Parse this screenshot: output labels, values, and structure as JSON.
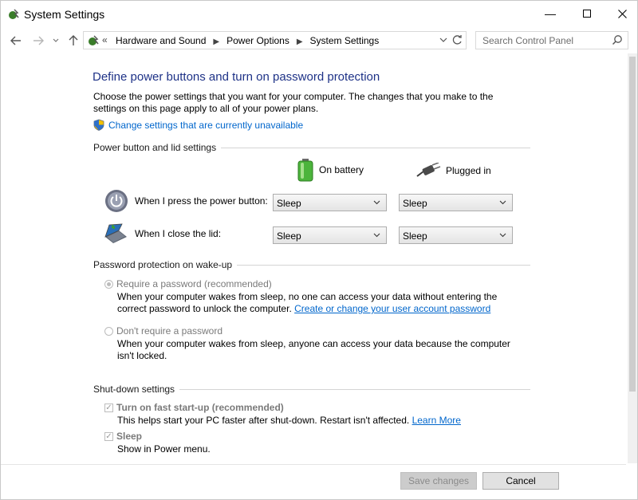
{
  "window": {
    "title": "System Settings",
    "minimize_icon": "minimize-icon",
    "maximize_icon": "maximize-icon",
    "close_icon": "close-icon"
  },
  "nav": {
    "overflow_chevron": "«",
    "breadcrumbs": [
      "Hardware and Sound",
      "Power Options",
      "System Settings"
    ],
    "search_placeholder": "Search Control Panel"
  },
  "page": {
    "heading": "Define power buttons and turn on password protection",
    "intro": "Choose the power settings that you want for your computer. The changes that you make to the settings on this page apply to all of your power plans.",
    "change_link": "Change settings that are currently unavailable"
  },
  "power_section": {
    "title": "Power button and lid settings",
    "col_battery": "On battery",
    "col_plugged": "Plugged in",
    "rows": [
      {
        "label": "When I press the power button:",
        "battery": "Sleep",
        "plugged": "Sleep"
      },
      {
        "label": "When I close the lid:",
        "battery": "Sleep",
        "plugged": "Sleep"
      }
    ]
  },
  "password_section": {
    "title": "Password protection on wake-up",
    "require_label": "Require a password (recommended)",
    "require_desc": "When your computer wakes from sleep, no one can access your data without entering the correct password to unlock the computer.",
    "require_link": "Create or change your user account password",
    "dont_label": "Don't require a password",
    "dont_desc": "When your computer wakes from sleep, anyone can access your data because the computer isn't locked.",
    "selected": "require"
  },
  "shutdown_section": {
    "title": "Shut-down settings",
    "fast_label": "Turn on fast start-up (recommended)",
    "fast_desc": "This helps start your PC faster after shut-down. Restart isn't affected.",
    "fast_link": "Learn More",
    "fast_checked": true,
    "sleep_label": "Sleep",
    "sleep_desc": "Show in Power menu.",
    "sleep_checked": true
  },
  "buttons": {
    "save": "Save changes",
    "cancel": "Cancel"
  },
  "colors": {
    "heading": "#1e3287",
    "link": "#0066cc",
    "disabled_text": "#7a7a7a"
  }
}
